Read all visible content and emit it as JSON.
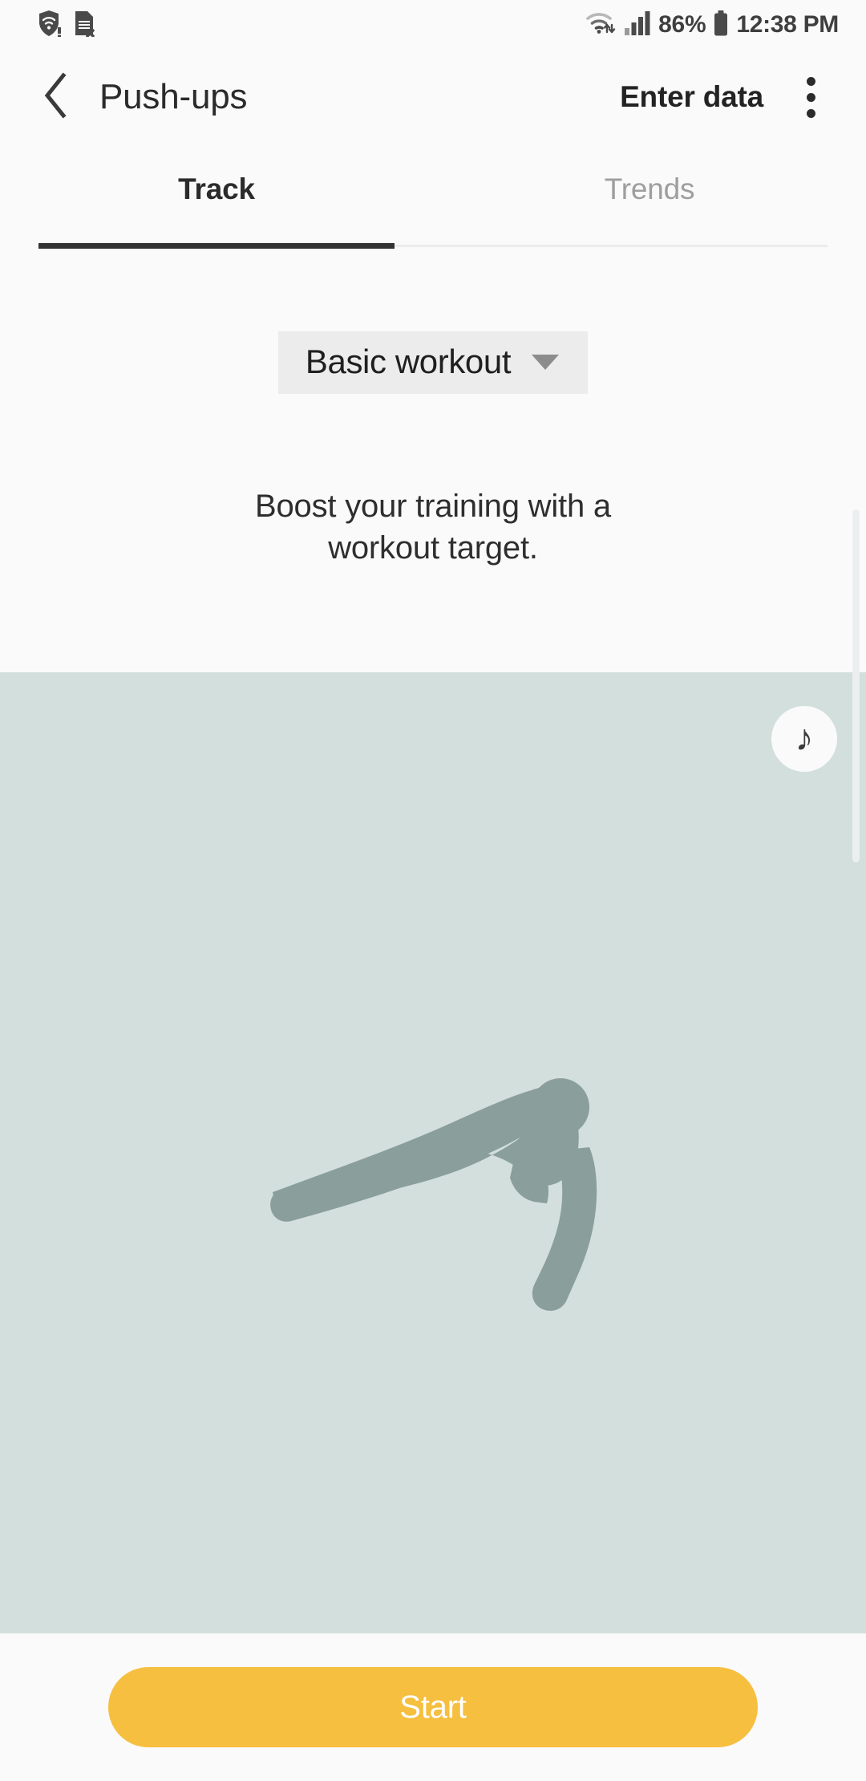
{
  "status_bar": {
    "icons_left": [
      "vpn-shield-alert-icon",
      "sim-card-error-icon"
    ],
    "wifi_icon": "wifi-transfer-icon",
    "signal_icon": "cellular-signal-icon",
    "battery_percent": "86%",
    "battery_icon": "battery-icon",
    "time": "12:38 PM"
  },
  "app_bar": {
    "back_icon": "chevron-left-icon",
    "title": "Push-ups",
    "enter_data_label": "Enter data",
    "more_icon": "overflow-menu-icon"
  },
  "tabs": [
    {
      "label": "Track",
      "active": true
    },
    {
      "label": "Trends",
      "active": false
    }
  ],
  "workout_selector": {
    "value": "Basic workout",
    "caret_icon": "caret-down-icon",
    "options": [
      "Basic workout"
    ]
  },
  "promo": {
    "line1": "Boost your training with a",
    "line2": "workout target."
  },
  "illustration": {
    "exercise": "push-up-figure",
    "music_icon": "music-note-icon",
    "music_glyph": "♪"
  },
  "bottom_bar": {
    "start_label": "Start"
  },
  "colors": {
    "page_background": "#fafafa",
    "illustration_background": "#d3dfdd",
    "figure": "#8a9e9b",
    "accent_button": "#f6bf3f",
    "tab_active_indicator": "#333333",
    "tab_inactive_text": "#9e9e9e",
    "selector_background": "#ececec"
  }
}
